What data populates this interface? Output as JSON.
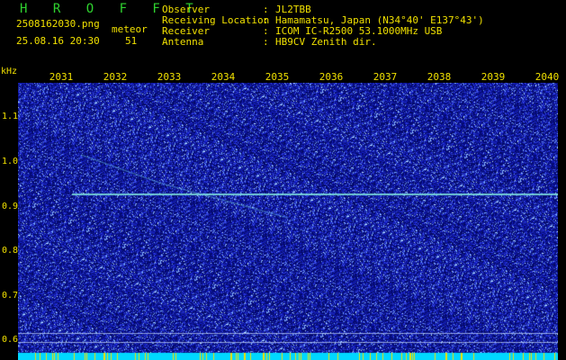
{
  "header": {
    "title": "H R O F F T",
    "filename": "2508162030.png",
    "datetime": "25.08.16 20:30",
    "event_label": "meteor",
    "event_count": "51"
  },
  "station": [
    {
      "key": "Observer",
      "value": "JL2TBB"
    },
    {
      "key": "Receiving Location",
      "value": "Hamamatsu, Japan (N34°40' E137°43')"
    },
    {
      "key": "Receiver",
      "value": "ICOM IC-R2500 53.1000MHz USB"
    },
    {
      "key": "Antenna",
      "value": "HB9CV Zenith dir."
    }
  ],
  "axis": {
    "unit": "kHz",
    "x_ticks": [
      "2031",
      "2032",
      "2033",
      "2034",
      "2035",
      "2036",
      "2037",
      "2038",
      "2039",
      "2040"
    ],
    "y_ticks": [
      "1.1",
      "1.0",
      "0.9",
      "0.8",
      "0.7",
      "0.6"
    ]
  },
  "colors": {
    "background": "#000000",
    "text": "#f0e000",
    "title": "#2fd22f",
    "noise_base": "#0d1a9a",
    "signal": "#7fe8e0",
    "bottom_bar": "#00d8ff"
  }
}
